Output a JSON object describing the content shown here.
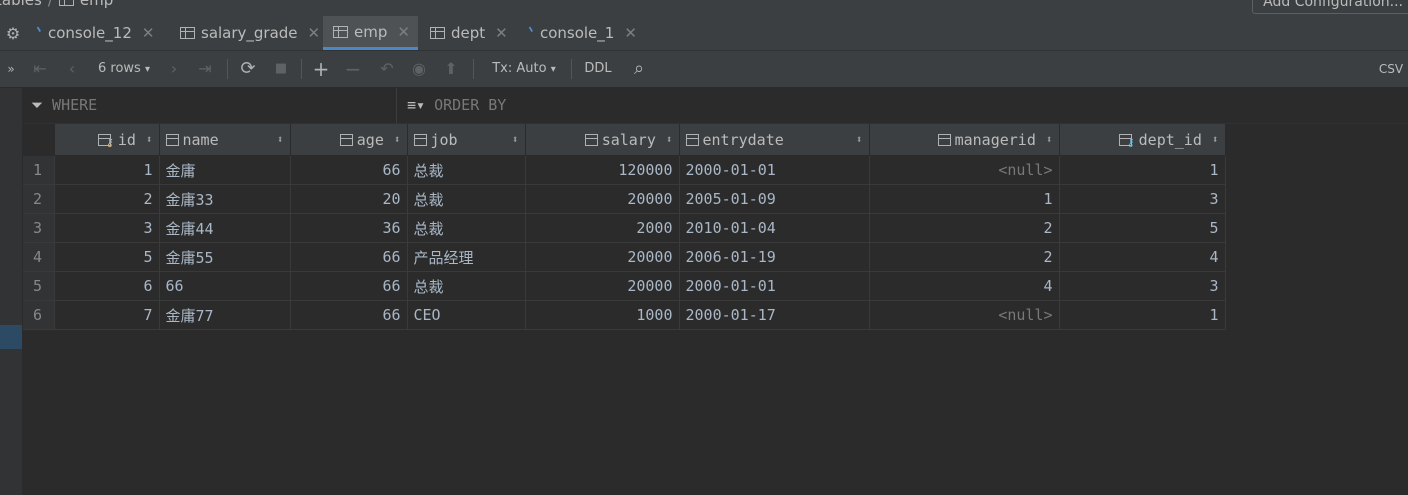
{
  "breadcrumb": {
    "parent": "tables",
    "current": "emp",
    "sep": "/"
  },
  "run_config_label": "Add Configuration...",
  "tabs": [
    {
      "label": "console_12",
      "type": "console"
    },
    {
      "label": "salary_grade",
      "type": "table"
    },
    {
      "label": "emp",
      "type": "table",
      "active": true
    },
    {
      "label": "dept",
      "type": "table"
    },
    {
      "label": "console_1",
      "type": "console"
    }
  ],
  "toolbar": {
    "rows_label": "6 rows",
    "tx_label": "Tx: Auto",
    "ddl_label": "DDL",
    "csv_label": "CSV"
  },
  "filter": {
    "where_label": "WHERE",
    "order_label": "ORDER BY"
  },
  "grid": {
    "columns": [
      {
        "name": "id",
        "key": "primary",
        "align": "right"
      },
      {
        "name": "name",
        "align": "left"
      },
      {
        "name": "age",
        "align": "right"
      },
      {
        "name": "job",
        "align": "left"
      },
      {
        "name": "salary",
        "align": "right"
      },
      {
        "name": "entrydate",
        "align": "left"
      },
      {
        "name": "managerid",
        "align": "right"
      },
      {
        "name": "dept_id",
        "key": "foreign",
        "align": "right"
      }
    ],
    "rows": [
      {
        "n": "1",
        "cells": [
          "1",
          "金庸",
          "66",
          "总裁",
          "120000",
          "2000-01-01",
          "<null>",
          "1"
        ]
      },
      {
        "n": "2",
        "cells": [
          "2",
          "金庸33",
          "20",
          "总裁",
          "20000",
          "2005-01-09",
          "1",
          "3"
        ]
      },
      {
        "n": "3",
        "cells": [
          "3",
          "金庸44",
          "36",
          "总裁",
          "2000",
          "2010-01-04",
          "2",
          "5"
        ]
      },
      {
        "n": "4",
        "cells": [
          "5",
          "金庸55",
          "66",
          "产品经理",
          "20000",
          "2006-01-19",
          "2",
          "4"
        ]
      },
      {
        "n": "5",
        "cells": [
          "6",
          "66",
          "66",
          "总裁",
          "20000",
          "2000-01-01",
          "4",
          "3"
        ]
      },
      {
        "n": "6",
        "cells": [
          "7",
          "金庸77",
          "66",
          "CEO",
          "1000",
          "2000-01-17",
          "<null>",
          "1"
        ]
      }
    ]
  }
}
